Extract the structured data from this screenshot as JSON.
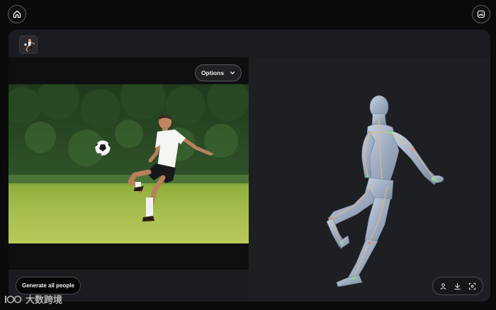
{
  "header": {
    "home_icon": "home-icon",
    "gallery_icon": "image-gallery-icon"
  },
  "panel": {
    "thumbnail_icon": "image-thumbnail",
    "options_label": "Options",
    "options_icon": "chevron-down-icon",
    "generate_label": "Generate all people",
    "toolbar_icons": [
      "person-icon",
      "download-icon",
      "fullscreen-icon"
    ]
  },
  "watermark": {
    "text": "大数跨境"
  }
}
